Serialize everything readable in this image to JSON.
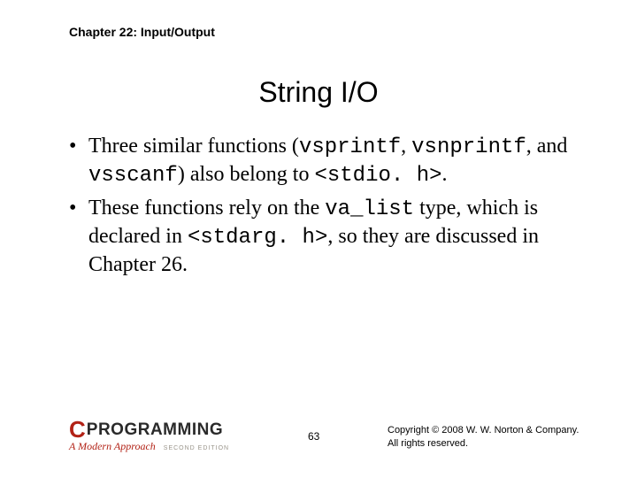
{
  "chapter": "Chapter 22: Input/Output",
  "title": "String I/O",
  "bullets": [
    {
      "pre": "Three similar functions (",
      "c1": "vsprintf",
      "mid1": ", ",
      "c2": "vsnprintf",
      "mid2": ", and ",
      "c3": "vsscanf",
      "mid3": ") also belong to ",
      "c4": "<stdio. h>",
      "post": "."
    },
    {
      "pre": "These functions rely on the ",
      "c1": "va_list",
      "mid1": " type, which is declared in ",
      "c2": "<stdarg. h>",
      "mid2": ", so they are discussed in Chapter 26.",
      "c3": "",
      "mid3": "",
      "c4": "",
      "post": ""
    }
  ],
  "logo": {
    "c": "C",
    "rest": "PROGRAMMING",
    "sub": "A Modern Approach",
    "edition": "SECOND EDITION"
  },
  "page": "63",
  "copyright_l1": "Copyright © 2008 W. W. Norton & Company.",
  "copyright_l2": "All rights reserved."
}
